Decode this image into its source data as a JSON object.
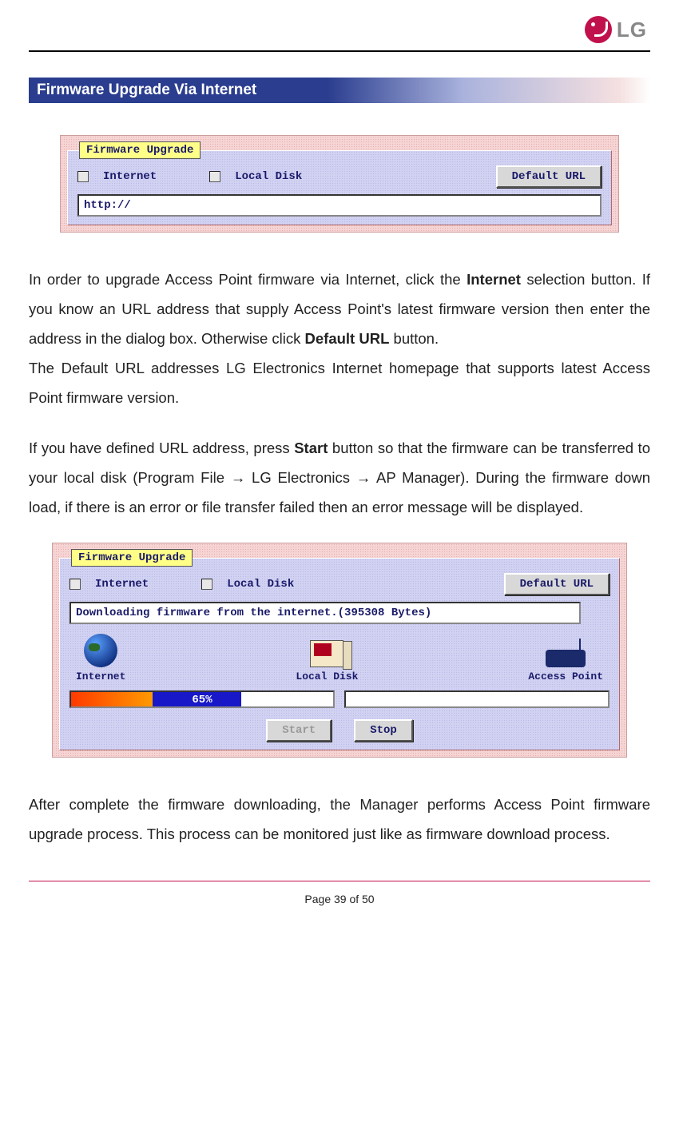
{
  "brand": {
    "name": "LG"
  },
  "section_title": "Firmware Upgrade Via Internet",
  "shot1": {
    "group_title": "Firmware Upgrade",
    "opt_internet": "Internet",
    "opt_local": "Local Disk",
    "default_url_btn": "Default URL",
    "url_value": "http://"
  },
  "para1_a": "In order to upgrade Access Point firmware via Internet, click the ",
  "para1_b": "Internet",
  "para1_c": " selection button. If you know an URL address that supply Access Point's latest firmware version then enter the address in the dialog box. Otherwise click ",
  "para1_d": "Default URL",
  "para1_e": " button.",
  "para1_f": "The Default URL addresses LG Electronics Internet homepage that supports latest Access Point firmware version.",
  "para2_a": "If you have defined URL address, press ",
  "para2_b": "Start",
  "para2_c": " button so that the firmware can be transferred to your local disk (Program File → LG Electronics → AP Manager). During the firmware down load, if there is an error or file transfer failed then an error message will be displayed.",
  "shot2": {
    "group_title": "Firmware Upgrade",
    "opt_internet": "Internet",
    "opt_local": "Local Disk",
    "default_url_btn": "Default URL",
    "status": "Downloading firmware from the internet.(395308 Bytes)",
    "label_internet": "Internet",
    "label_localdisk": "Local Disk",
    "label_ap": "Access Point",
    "progress_text": "65%",
    "start_btn": "Start",
    "stop_btn": "Stop"
  },
  "para3": "After complete the firmware downloading, the Manager performs Access Point firmware upgrade process. This process can be monitored just like as firmware download process.",
  "page_number": "Page 39 of 50"
}
